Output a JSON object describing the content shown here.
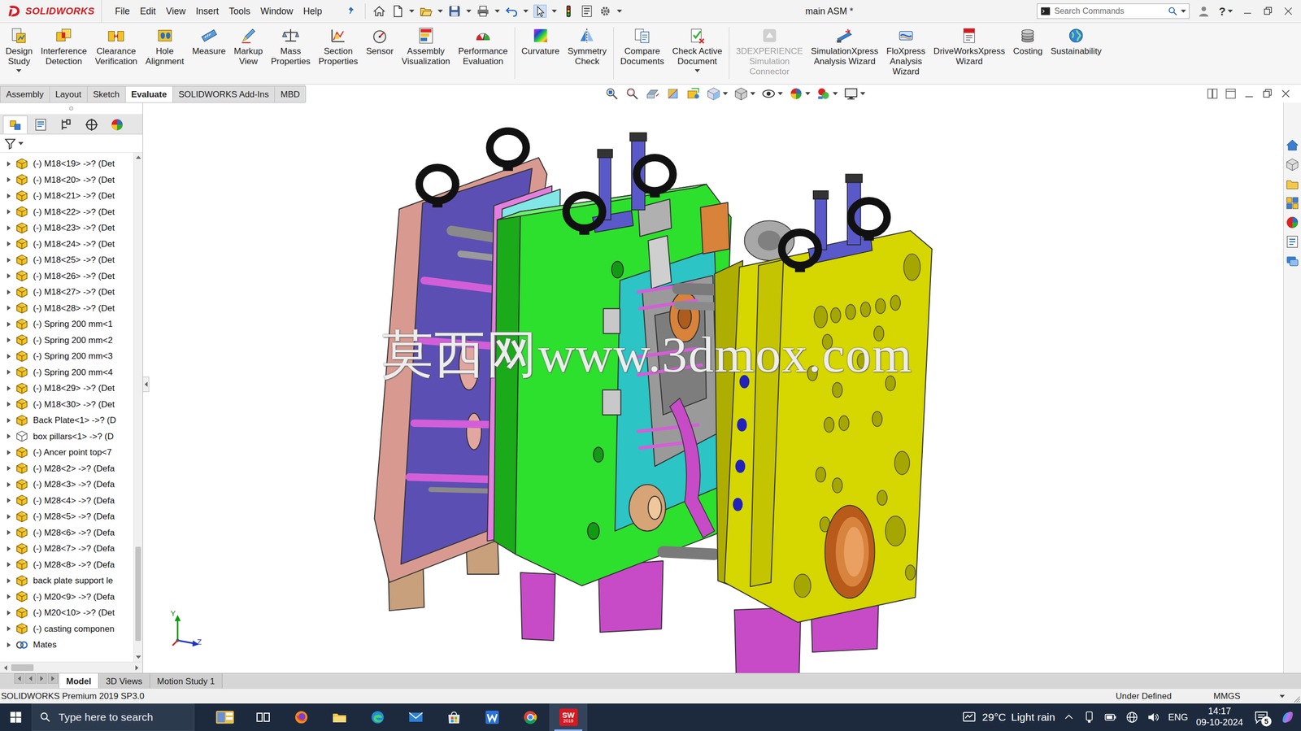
{
  "window": {
    "title": "main ASM *"
  },
  "app": {
    "logo_text": "SOLIDWORKS"
  },
  "menu": [
    "File",
    "Edit",
    "View",
    "Insert",
    "Tools",
    "Window",
    "Help"
  ],
  "search": {
    "placeholder": "Search Commands"
  },
  "help": "?",
  "ribbon": [
    {
      "lines": [
        "Design",
        "Study"
      ],
      "has_menu": true,
      "disabled": false,
      "group": 0
    },
    {
      "lines": [
        "Interference",
        "Detection"
      ],
      "has_menu": false,
      "disabled": false,
      "group": 0
    },
    {
      "lines": [
        "Clearance",
        "Verification"
      ],
      "has_menu": false,
      "disabled": false,
      "group": 0
    },
    {
      "lines": [
        "Hole",
        "Alignment"
      ],
      "has_menu": false,
      "disabled": false,
      "group": 0
    },
    {
      "lines": [
        "Measure"
      ],
      "has_menu": false,
      "disabled": false,
      "group": 0
    },
    {
      "lines": [
        "Markup",
        "View"
      ],
      "has_menu": false,
      "disabled": false,
      "group": 0
    },
    {
      "lines": [
        "Mass",
        "Properties"
      ],
      "has_menu": false,
      "disabled": false,
      "group": 0
    },
    {
      "lines": [
        "Section",
        "Properties"
      ],
      "has_menu": false,
      "disabled": false,
      "group": 0
    },
    {
      "lines": [
        "Sensor"
      ],
      "has_menu": false,
      "disabled": false,
      "group": 0
    },
    {
      "lines": [
        "Assembly",
        "Visualization"
      ],
      "has_menu": false,
      "disabled": false,
      "group": 0
    },
    {
      "lines": [
        "Performance",
        "Evaluation"
      ],
      "has_menu": false,
      "disabled": false,
      "group": 0
    },
    {
      "lines": [
        "Curvature"
      ],
      "has_menu": false,
      "disabled": false,
      "group": 1
    },
    {
      "lines": [
        "Symmetry",
        "Check"
      ],
      "has_menu": false,
      "disabled": false,
      "group": 1
    },
    {
      "lines": [
        "Compare",
        "Documents"
      ],
      "has_menu": false,
      "disabled": false,
      "group": 2
    },
    {
      "lines": [
        "Check Active",
        "Document"
      ],
      "has_menu": true,
      "disabled": false,
      "group": 2
    },
    {
      "lines": [
        "3DEXPERIENCE",
        "Simulation",
        "Connector"
      ],
      "has_menu": false,
      "disabled": true,
      "group": 3
    },
    {
      "lines": [
        "SimulationXpress",
        "Analysis Wizard"
      ],
      "has_menu": false,
      "disabled": false,
      "group": 3
    },
    {
      "lines": [
        "FloXpress",
        "Analysis",
        "Wizard"
      ],
      "has_menu": false,
      "disabled": false,
      "group": 3
    },
    {
      "lines": [
        "DriveWorksXpress",
        "Wizard"
      ],
      "has_menu": false,
      "disabled": false,
      "group": 3
    },
    {
      "lines": [
        "Costing"
      ],
      "has_menu": false,
      "disabled": false,
      "group": 3
    },
    {
      "lines": [
        "Sustainability"
      ],
      "has_menu": false,
      "disabled": false,
      "group": 3
    }
  ],
  "command_tabs": [
    {
      "label": "Assembly",
      "selected": false
    },
    {
      "label": "Layout",
      "selected": false
    },
    {
      "label": "Sketch",
      "selected": false
    },
    {
      "label": "Evaluate",
      "selected": true
    },
    {
      "label": "SOLIDWORKS Add-Ins",
      "selected": false
    },
    {
      "label": "MBD",
      "selected": false
    }
  ],
  "tree": {
    "panel_tabs": [
      {
        "selected": true
      },
      {
        "selected": false
      },
      {
        "selected": false
      },
      {
        "selected": false
      },
      {
        "selected": false
      }
    ],
    "items": [
      {
        "label": "(-) M18<19> ->? (Det",
        "kind": "part",
        "expanded": false
      },
      {
        "label": "(-) M18<20> ->? (Det",
        "kind": "part",
        "expanded": false
      },
      {
        "label": "(-) M18<21> ->? (Det",
        "kind": "part",
        "expanded": false
      },
      {
        "label": "(-) M18<22> ->? (Det",
        "kind": "part",
        "expanded": false
      },
      {
        "label": "(-) M18<23> ->? (Det",
        "kind": "part",
        "expanded": false
      },
      {
        "label": "(-) M18<24> ->? (Det",
        "kind": "part",
        "expanded": false
      },
      {
        "label": "(-) M18<25> ->? (Det",
        "kind": "part",
        "expanded": false
      },
      {
        "label": "(-) M18<26> ->? (Det",
        "kind": "part",
        "expanded": false
      },
      {
        "label": "(-) M18<27> ->? (Det",
        "kind": "part",
        "expanded": false
      },
      {
        "label": "(-) M18<28> ->? (Det",
        "kind": "part",
        "expanded": false
      },
      {
        "label": "(-) Spring 200 mm<1",
        "kind": "part",
        "expanded": false
      },
      {
        "label": "(-) Spring 200 mm<2",
        "kind": "part",
        "expanded": false
      },
      {
        "label": "(-) Spring 200 mm<3",
        "kind": "part",
        "expanded": false
      },
      {
        "label": "(-) Spring 200 mm<4",
        "kind": "part",
        "expanded": false
      },
      {
        "label": "(-) M18<29> ->? (Det",
        "kind": "part",
        "expanded": false
      },
      {
        "label": "(-) M18<30> ->? (Det",
        "kind": "part",
        "expanded": false
      },
      {
        "label": "Back Plate<1> ->? (D",
        "kind": "part",
        "expanded": false
      },
      {
        "label": "box pillars<1> ->? (D",
        "kind": "outline",
        "expanded": false
      },
      {
        "label": "(-) Ancer point top<7",
        "kind": "part",
        "expanded": false
      },
      {
        "label": "(-) M28<2> ->? (Defa",
        "kind": "part",
        "expanded": false
      },
      {
        "label": "(-) M28<3> ->? (Defa",
        "kind": "part",
        "expanded": false
      },
      {
        "label": "(-) M28<4> ->? (Defa",
        "kind": "part",
        "expanded": false
      },
      {
        "label": "(-) M28<5> ->? (Defa",
        "kind": "part",
        "expanded": false
      },
      {
        "label": "(-) M28<6> ->? (Defa",
        "kind": "part",
        "expanded": false
      },
      {
        "label": "(-) M28<7> ->? (Defa",
        "kind": "part",
        "expanded": false
      },
      {
        "label": "(-) M28<8> ->? (Defa",
        "kind": "part",
        "expanded": false
      },
      {
        "label": "back plate support le",
        "kind": "part",
        "expanded": false
      },
      {
        "label": "(-) M20<9> ->? (Defa",
        "kind": "part",
        "expanded": false
      },
      {
        "label": "(-) M20<10> ->? (Det",
        "kind": "part",
        "expanded": false
      },
      {
        "label": "(-) casting componen",
        "kind": "part",
        "expanded": false
      },
      {
        "label": "Mates",
        "kind": "mates",
        "expanded": false
      }
    ],
    "scroll": {
      "level": 0.97
    },
    "hscroll": {
      "level": 0
    }
  },
  "watermark": "莫西网www.3dmox.com",
  "triad": {
    "y": "Y",
    "z": "Z"
  },
  "bottom_tabs": [
    {
      "label": "Model",
      "selected": true
    },
    {
      "label": "3D Views",
      "selected": false
    },
    {
      "label": "Motion Study 1",
      "selected": false
    }
  ],
  "status_bar": {
    "product": "SOLIDWORKS Premium 2019 SP3.0",
    "state": "Under Defined",
    "units": "MMGS"
  },
  "taskbar": {
    "search_placeholder": "Type here to search",
    "apps": [
      {
        "kind": "widgets",
        "active": false
      },
      {
        "kind": "taskview",
        "active": false
      },
      {
        "kind": "firefox",
        "active": false
      },
      {
        "kind": "explorer",
        "active": false
      },
      {
        "kind": "edge",
        "active": false
      },
      {
        "kind": "mail",
        "active": false
      },
      {
        "kind": "store",
        "active": false
      },
      {
        "kind": "wapp",
        "active": false
      },
      {
        "kind": "chrome",
        "active": false
      },
      {
        "kind": "solidworks",
        "active": true,
        "label": "SW",
        "version": "2019"
      }
    ],
    "weather": {
      "temp": "29°C",
      "text": "Light rain"
    },
    "language": "ENG",
    "time": "14:17",
    "date": "09-10-2024",
    "notifications": "5"
  }
}
